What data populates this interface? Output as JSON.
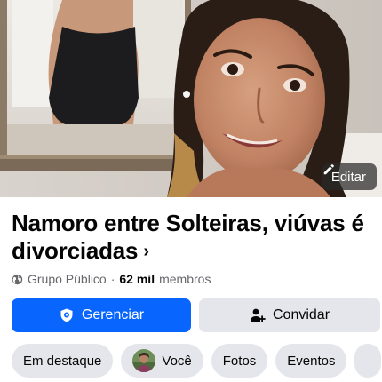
{
  "cover": {
    "edit_label": "Editar",
    "edit_icon": "pencil-icon"
  },
  "group": {
    "name": "Namoro entre Solteiras, viúvas é divorciadas",
    "chevron": "›",
    "privacy": "Grupo Público",
    "privacy_icon": "globe-icon",
    "separator": "·",
    "member_count": "62 mil",
    "member_label": "membros"
  },
  "actions": {
    "manage_label": "Gerenciar",
    "manage_icon": "shield-icon",
    "invite_label": "Convidar",
    "invite_icon": "add-person-icon"
  },
  "tabs": [
    {
      "label": "Em destaque"
    },
    {
      "label": "Você",
      "has_avatar": true
    },
    {
      "label": "Fotos"
    },
    {
      "label": "Eventos"
    }
  ],
  "colors": {
    "primary_button": "#0866ff",
    "secondary_button": "#e4e6eb",
    "edit_button_bg": "rgba(40,40,40,0.72)",
    "meta_text": "#65676b"
  }
}
